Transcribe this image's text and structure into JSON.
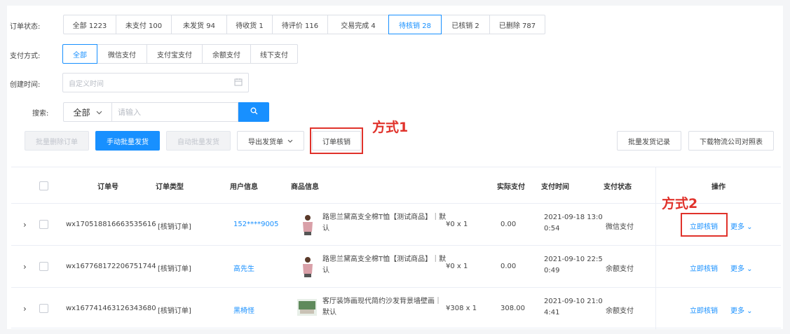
{
  "filters": {
    "status_label": "订单状态:",
    "status_tabs": [
      "全部 1223",
      "未支付 100",
      "未发货 94",
      "待收货 1",
      "待评价 116",
      "交易完成 4",
      "待核销 28",
      "已核销 2",
      "已删除 787"
    ],
    "pay_label": "支付方式:",
    "pay_tabs": [
      "全部",
      "微信支付",
      "支付宝支付",
      "余额支付",
      "线下支付"
    ],
    "date_label": "创建时间:",
    "date_placeholder": "自定义时间",
    "search_label": "搜索:",
    "search_select": "全部",
    "search_placeholder": "请输入"
  },
  "toolbar": {
    "batch_delete": "批量删除订单",
    "manual_ship": "手动批量发货",
    "auto_ship": "自动批量发货",
    "export": "导出发货单",
    "verify": "订单核销",
    "ship_records": "批量发货记录",
    "download_logistics": "下载物流公司对照表"
  },
  "annotations": {
    "way1": "方式1",
    "way2": "方式2"
  },
  "table": {
    "headers": {
      "order_no": "订单号",
      "order_type": "订单类型",
      "user": "用户信息",
      "product": "商品信息",
      "paid": "实际支付",
      "pay_time": "支付时间",
      "pay_status": "支付状态",
      "ops": "操作"
    },
    "rows": [
      {
        "order_no": "wx170518816663535616",
        "type": "[核销订单]",
        "user": "152****9005",
        "product": "路思兰黛高支全棉T恤【测试商品】｜默认",
        "price": "¥0 x 1",
        "paid": "0.00",
        "time1": "2021-09-18 13:0",
        "time2": "0:54",
        "status": "微信支付",
        "action": "立即核销",
        "more": "更多"
      },
      {
        "order_no": "wx167768172206751744",
        "type": "[核销订单]",
        "user": "高先生",
        "product": "路思兰黛高支全棉T恤【测试商品】｜默认",
        "price": "¥0 x 1",
        "paid": "0.00",
        "time1": "2021-09-10 22:5",
        "time2": "0:49",
        "status": "余额支付",
        "action": "立即核销",
        "more": "更多"
      },
      {
        "order_no": "wx167741463126343680",
        "type": "[核销订单]",
        "user": "黑椅怪",
        "product": "客厅装饰画现代简约沙发背景墙壁画｜默认",
        "price": "¥308 x 1",
        "paid": "308.00",
        "time1": "2021-09-10 21:0",
        "time2": "4:41",
        "status": "余额支付",
        "action": "立即核销",
        "more": "更多"
      }
    ]
  }
}
